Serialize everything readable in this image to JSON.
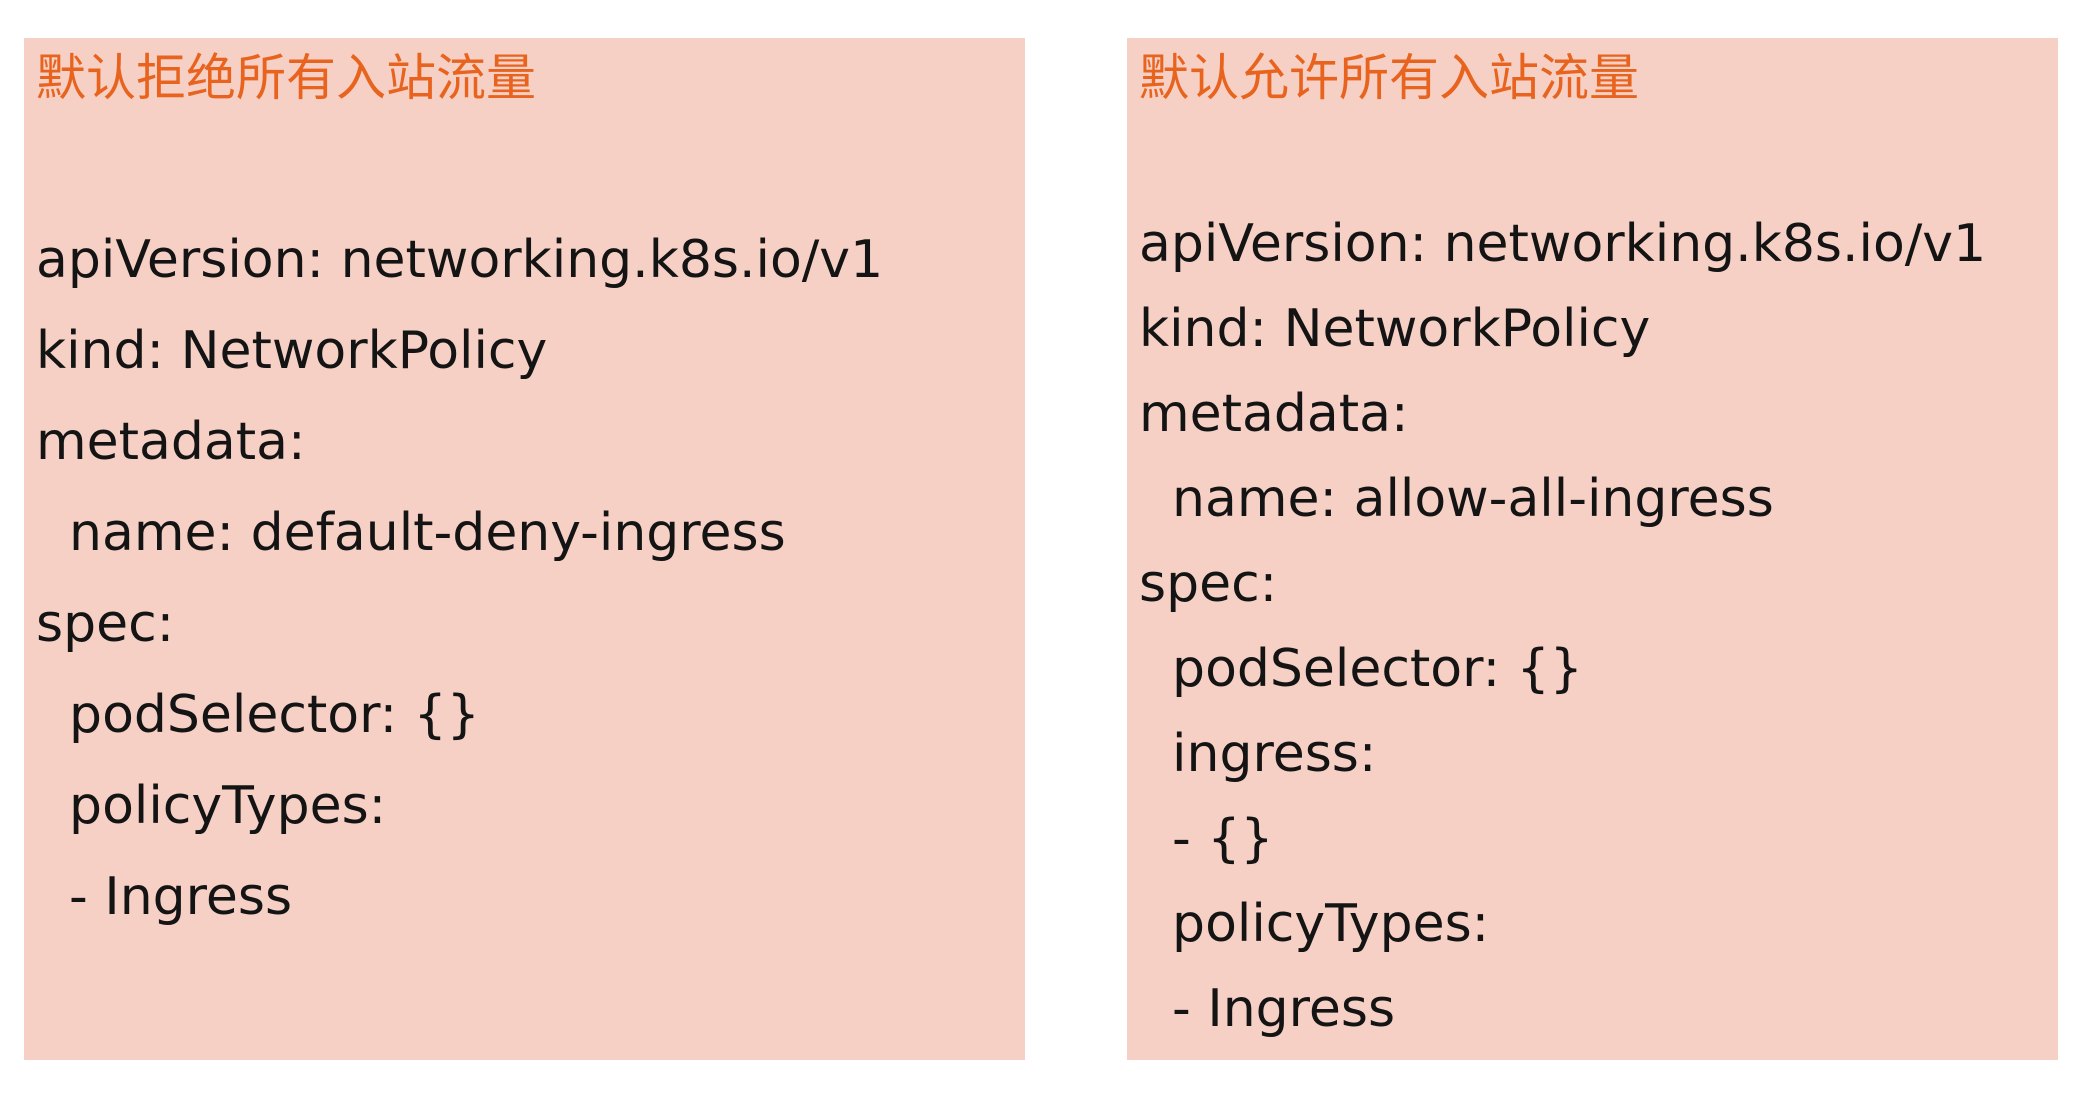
{
  "colors": {
    "panel_background": "#f6d0c5",
    "title": "#e8641e",
    "code_text": "#141414"
  },
  "left_panel": {
    "title": "默认拒绝所有入站流量",
    "lines": [
      "apiVersion: networking.k8s.io/v1",
      "kind: NetworkPolicy",
      "metadata:",
      "  name: default-deny-ingress",
      "spec:",
      "  podSelector: {}",
      "  policyTypes:",
      "  - Ingress"
    ]
  },
  "right_panel": {
    "title": "默认允许所有入站流量",
    "lines": [
      "apiVersion: networking.k8s.io/v1",
      "kind: NetworkPolicy",
      "metadata:",
      "  name: allow-all-ingress",
      "spec:",
      "  podSelector: {}",
      "  ingress:",
      "  - {}",
      "  policyTypes:",
      "  - Ingress"
    ]
  }
}
